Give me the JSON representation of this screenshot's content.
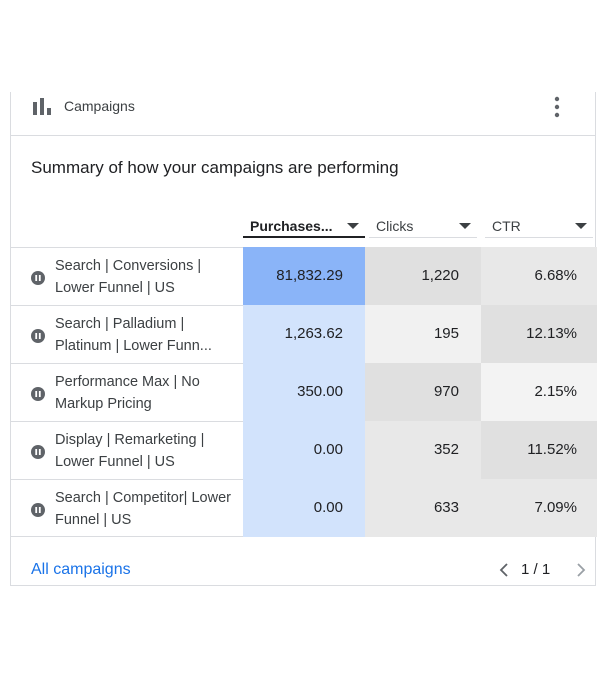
{
  "card": {
    "title": "Campaigns",
    "icon": "bar-chart-icon",
    "summary": "Summary of how your campaigns are performing"
  },
  "columns": [
    {
      "label": "Purchases...",
      "active": true
    },
    {
      "label": "Clicks",
      "active": false
    },
    {
      "label": "CTR",
      "active": false
    }
  ],
  "rows": [
    {
      "name": "Search | Conversions | Lower Funnel | US",
      "purchases": "81,832.29",
      "clicks": "1,220",
      "ctr": "6.68%"
    },
    {
      "name": "Search | Palladium | Platinum | Lower Funn...",
      "purchases": "1,263.62",
      "clicks": "195",
      "ctr": "12.13%"
    },
    {
      "name": "Performance Max | No Markup Pricing",
      "purchases": "350.00",
      "clicks": "970",
      "ctr": "2.15%"
    },
    {
      "name": "Display | Remarketing | Lower Funnel | US",
      "purchases": "0.00",
      "clicks": "352",
      "ctr": "11.52%"
    },
    {
      "name": "Search | Competitor| Lower Funnel | US",
      "purchases": "0.00",
      "clicks": "633",
      "ctr": "7.09%"
    }
  ],
  "heat": {
    "purchases": [
      "#8ab4f8",
      "#d2e3fc",
      "#d2e3fc",
      "#d2e3fc",
      "#d2e3fc"
    ],
    "clicks": [
      "#e0e0e0",
      "#f1f1f1",
      "#e0e0e0",
      "#e8e8e8",
      "#e8e8e8"
    ],
    "ctr": [
      "#e8e8e8",
      "#e0e0e0",
      "#f3f3f3",
      "#e0e0e0",
      "#e8e8e8"
    ]
  },
  "footer": {
    "link": "All campaigns",
    "pager": "1 / 1"
  },
  "colors": {
    "accent": "#1a73e8",
    "divider": "#dadce0",
    "icon": "#5f6368"
  }
}
